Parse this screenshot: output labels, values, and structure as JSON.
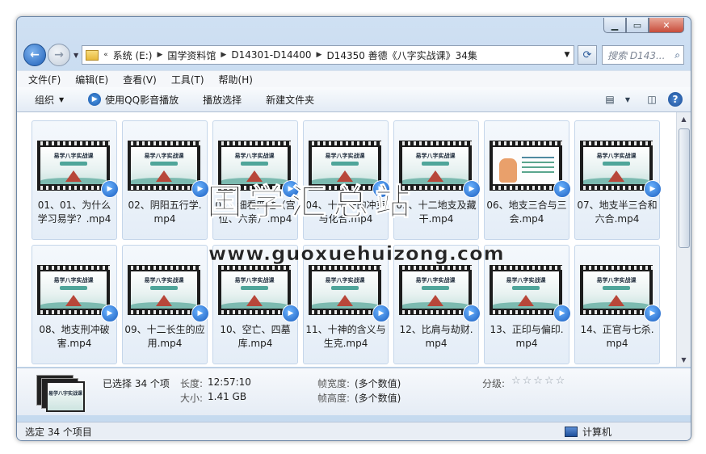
{
  "address": {
    "breadcrumbs": [
      "系统 (E:)",
      "国学资料馆",
      "D14301-D14400",
      "D14350 善德《八字实战课》34集"
    ],
    "overflow": "«"
  },
  "search": {
    "placeholder": "搜索 D143..."
  },
  "menu": [
    "文件(F)",
    "编辑(E)",
    "查看(V)",
    "工具(T)",
    "帮助(H)"
  ],
  "toolbar": {
    "organize": "组织",
    "play_qq": "使用QQ影音播放",
    "playlist": "播放选择",
    "new_folder": "新建文件夹"
  },
  "thumb_title": "易学八字实战课",
  "files": [
    "01、01、为什么学习易学？.mp4",
    "02、阴阳五行学.mp4",
    "03、细看四柱（宫位、六亲）.mp4",
    "04、十天干的冲克与化合.mp4",
    "05、十二地支及藏干.mp4",
    "06、地支三合与三会.mp4",
    "07、地支半三合和六合.mp4",
    "08、地支刑冲破害.mp4",
    "09、十二长生的应用.mp4",
    "10、空亡、四墓库.mp4",
    "11、十神的含义与生克.mp4",
    "12、比肩与劫财.mp4",
    "13、正印与偏印.mp4",
    "14、正官与七杀.mp4"
  ],
  "details": {
    "selected": "已选择 34 个项",
    "length_key": "长度:",
    "length_val": "12:57:10",
    "size_key": "大小:",
    "size_val": "1.41 GB",
    "fw_key": "帧宽度:",
    "fw_val": "(多个数值)",
    "fh_key": "帧高度:",
    "fh_val": "(多个数值)",
    "rating_key": "分级:",
    "rating_stars": "☆☆☆☆☆"
  },
  "status": {
    "left": "选定 34 个项目",
    "right": "计算机"
  },
  "watermark": {
    "cn": "国学汇总站",
    "url": "www.guoxuehuizong.com"
  }
}
